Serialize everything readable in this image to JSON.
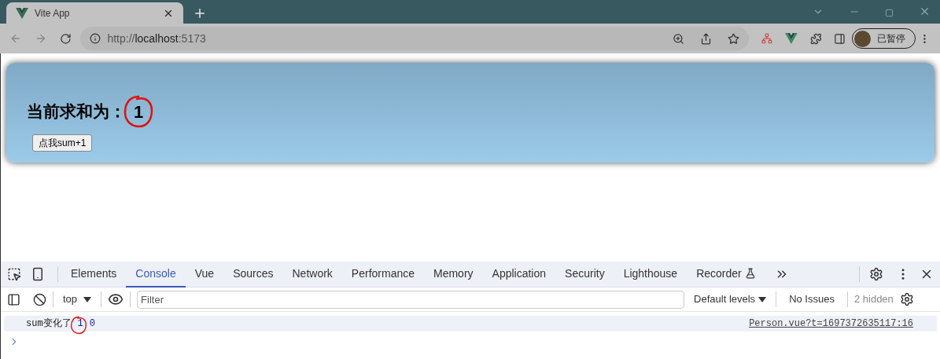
{
  "browser": {
    "tab_title": "Vite App",
    "url_scheme": "http://",
    "url_host": "localhost",
    "url_port": ":5173",
    "profile_label": "已暂停"
  },
  "page": {
    "heading": "当前求和为：",
    "sum": "1",
    "button": "点我sum+1"
  },
  "devtools": {
    "tabs": [
      {
        "label": "Elements",
        "selected": false
      },
      {
        "label": "Console",
        "selected": true
      },
      {
        "label": "Vue",
        "selected": false
      },
      {
        "label": "Sources",
        "selected": false
      },
      {
        "label": "Network",
        "selected": false
      },
      {
        "label": "Performance",
        "selected": false
      },
      {
        "label": "Memory",
        "selected": false
      },
      {
        "label": "Application",
        "selected": false
      },
      {
        "label": "Security",
        "selected": false
      },
      {
        "label": "Lighthouse",
        "selected": false
      },
      {
        "label": "Recorder",
        "selected": false
      }
    ],
    "context": "top",
    "filter_placeholder": "Filter",
    "levels": "Default levels",
    "issues": "No Issues",
    "hidden": "2 hidden",
    "messages": [
      {
        "text": "sum变化了",
        "values": [
          "1",
          "0"
        ],
        "source": "Person.vue?t=1697372635117:16"
      }
    ]
  },
  "annotations": [
    {
      "kind": "circle"
    },
    {
      "kind": "circle"
    }
  ]
}
